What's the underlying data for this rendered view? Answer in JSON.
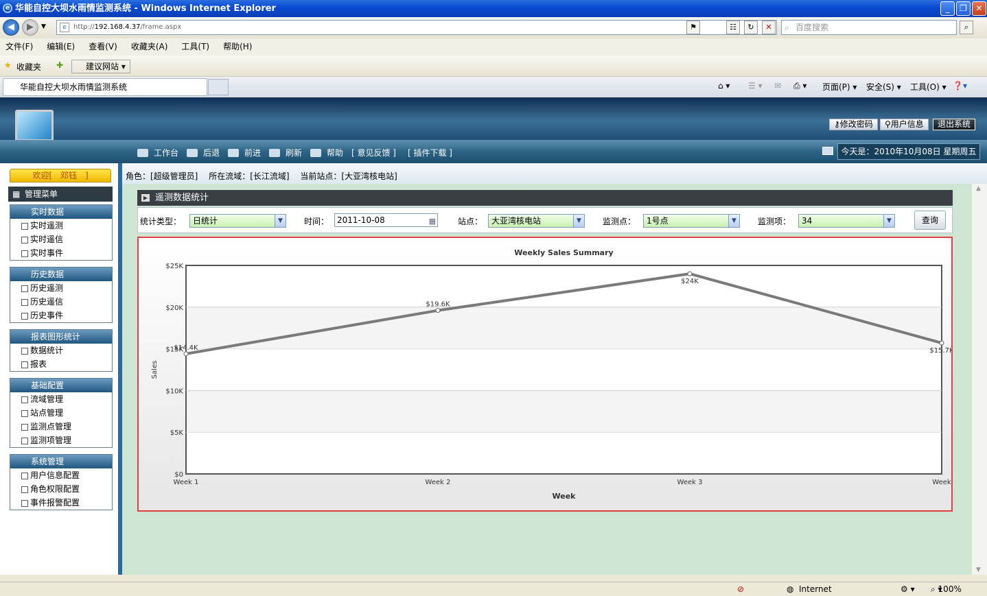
{
  "window": {
    "title": "华能自控大坝水雨情监测系统 - Windows Internet Explorer"
  },
  "browser": {
    "url_prefix": "http://",
    "url_host": "192.168.4.37",
    "url_path": "/frame.aspx",
    "search_placeholder": "百度搜索",
    "menu": [
      "文件(F)",
      "编辑(E)",
      "查看(V)",
      "收藏夹(A)",
      "工具(T)",
      "帮助(H)"
    ],
    "favorites_label": "收藏夹",
    "suggested_sites": "建议网站",
    "tab_title": "华能自控大坝水雨情监测系统",
    "cmd_page": "页面(P)",
    "cmd_safety": "安全(S)",
    "cmd_tools": "工具(O)",
    "status_zone": "Internet",
    "zoom": "100%"
  },
  "header": {
    "change_password": "修改密码",
    "user_info": "用户信息",
    "logout": "退出系统",
    "nav": [
      "工作台",
      "后退",
      "前进",
      "刷新",
      "帮助",
      "[ 意见反馈 ]",
      "[ 插件下载 ]"
    ],
    "today": "今天是：2010年10月08日 星期周五"
  },
  "sidebar": {
    "welcome": "欢迎[　邓钰　]",
    "menu_title": "管理菜单",
    "groups": [
      {
        "title": "实时数据",
        "items": [
          "实时遥测",
          "实时遥信",
          "实时事件"
        ]
      },
      {
        "title": "历史数据",
        "items": [
          "历史遥测",
          "历史遥信",
          "历史事件"
        ]
      },
      {
        "title": "报表图形统计",
        "items": [
          "数据统计",
          "报表"
        ]
      },
      {
        "title": "基础配置",
        "items": [
          "流域管理",
          "站点管理",
          "监测点管理",
          "监测项管理"
        ]
      },
      {
        "title": "系统管理",
        "items": [
          "用户信息配置",
          "角色权限配置",
          "事件报警配置"
        ]
      }
    ]
  },
  "infobar": {
    "role": "角色：[超级管理员]",
    "basin": "所在流域：[长江流域]",
    "station": "当前站点：[大亚湾核电站]"
  },
  "panel": {
    "title": "遥测数据统计"
  },
  "filters": {
    "type_label": "统计类型：",
    "type_value": "日统计",
    "time_label": "时间：",
    "time_value": "2011-10-08",
    "station_label": "站点：",
    "station_value": "大亚湾核电站",
    "point_label": "监测点：",
    "point_value": "1号点",
    "item_label": "监测项：",
    "item_value": "34",
    "query": "查询"
  },
  "colors": {
    "line": "#7a7a7a",
    "grid": "#cfcfcf",
    "border": "#e04040"
  },
  "chart_data": {
    "type": "line",
    "title": "Weekly Sales Summary",
    "xlabel": "Week",
    "ylabel": "Sales",
    "categories": [
      "Week 1",
      "Week 2",
      "Week 3",
      "Week"
    ],
    "values": [
      14400,
      19600,
      24000,
      15700
    ],
    "value_labels": [
      "$14.4K",
      "$19.6K",
      "$24K",
      "$15.7K"
    ],
    "yticks": [
      "$0",
      "$5K",
      "$10K",
      "$15K",
      "$20K",
      "$25K"
    ],
    "ylim": [
      0,
      25000
    ],
    "grid": true
  }
}
